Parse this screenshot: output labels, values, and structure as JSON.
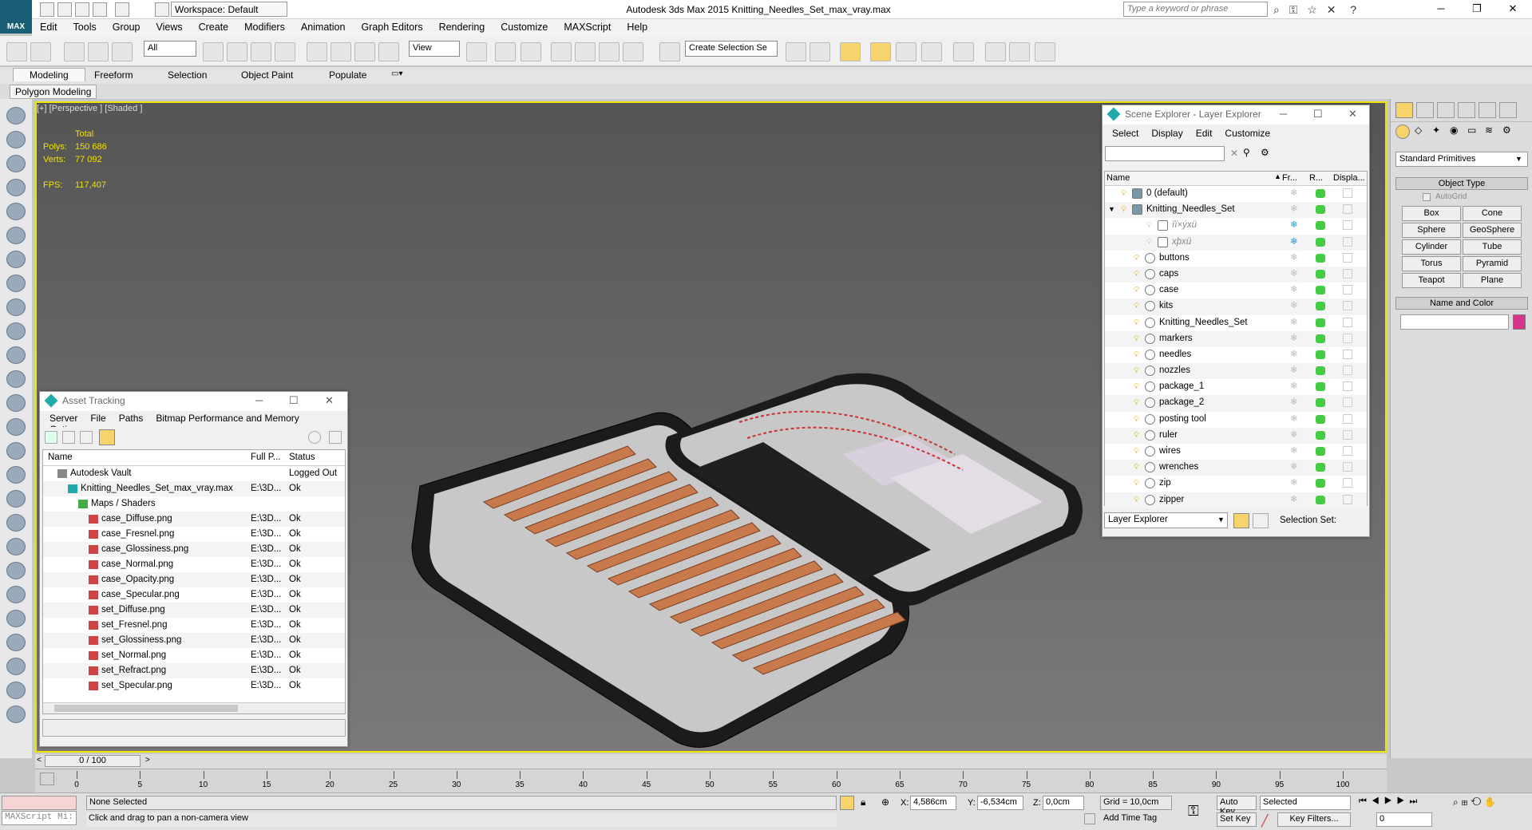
{
  "app": {
    "title": "Autodesk 3ds Max  2015    Knitting_Needles_Set_max_vray.max",
    "logo": "MAX",
    "workspace": "Workspace: Default",
    "search_placeholder": "Type a keyword or phrase"
  },
  "menu": [
    "Edit",
    "Tools",
    "Group",
    "Views",
    "Create",
    "Modifiers",
    "Animation",
    "Graph Editors",
    "Rendering",
    "Customize",
    "MAXScript",
    "Help"
  ],
  "toolbar": {
    "filter": "All",
    "refcoord": "View",
    "selset": "Create Selection Se"
  },
  "ribbon": {
    "tabs": [
      "Modeling",
      "Freeform",
      "Selection",
      "Object Paint",
      "Populate"
    ],
    "sub": "Polygon Modeling"
  },
  "viewport": {
    "label": "[+] [Perspective ] [Shaded ]",
    "stats": {
      "total": "Total",
      "polys_label": "Polys:",
      "polys": "150 686",
      "verts_label": "Verts:",
      "verts": "77 092",
      "fps_label": "FPS:",
      "fps": "117,407"
    }
  },
  "asset": {
    "title": "Asset Tracking",
    "menu": [
      "Server",
      "File",
      "Paths",
      "Bitmap Performance and Memory",
      "Options"
    ],
    "cols": [
      "Name",
      "Full P...",
      "Status"
    ],
    "rows": [
      {
        "name": "Autodesk Vault",
        "path": "",
        "status": "Logged Out",
        "indent": 0
      },
      {
        "name": "Knitting_Needles_Set_max_vray.max",
        "path": "E:\\3D...",
        "status": "Ok",
        "indent": 1
      },
      {
        "name": "Maps / Shaders",
        "path": "",
        "status": "",
        "indent": 2
      },
      {
        "name": "case_Diffuse.png",
        "path": "E:\\3D...",
        "status": "Ok",
        "indent": 3
      },
      {
        "name": "case_Fresnel.png",
        "path": "E:\\3D...",
        "status": "Ok",
        "indent": 3
      },
      {
        "name": "case_Glossiness.png",
        "path": "E:\\3D...",
        "status": "Ok",
        "indent": 3
      },
      {
        "name": "case_Normal.png",
        "path": "E:\\3D...",
        "status": "Ok",
        "indent": 3
      },
      {
        "name": "case_Opacity.png",
        "path": "E:\\3D...",
        "status": "Ok",
        "indent": 3
      },
      {
        "name": "case_Specular.png",
        "path": "E:\\3D...",
        "status": "Ok",
        "indent": 3
      },
      {
        "name": "set_Diffuse.png",
        "path": "E:\\3D...",
        "status": "Ok",
        "indent": 3
      },
      {
        "name": "set_Fresnel.png",
        "path": "E:\\3D...",
        "status": "Ok",
        "indent": 3
      },
      {
        "name": "set_Glossiness.png",
        "path": "E:\\3D...",
        "status": "Ok",
        "indent": 3
      },
      {
        "name": "set_Normal.png",
        "path": "E:\\3D...",
        "status": "Ok",
        "indent": 3
      },
      {
        "name": "set_Refract.png",
        "path": "E:\\3D...",
        "status": "Ok",
        "indent": 3
      },
      {
        "name": "set_Specular.png",
        "path": "E:\\3D...",
        "status": "Ok",
        "indent": 3
      }
    ]
  },
  "scene": {
    "title": "Scene Explorer - Layer Explorer",
    "menu": [
      "Select",
      "Display",
      "Edit",
      "Customize"
    ],
    "cols": [
      "Name",
      "Fr...",
      "R...",
      "Displa..."
    ],
    "rows": [
      {
        "name": "0 (default)",
        "indent": 0
      },
      {
        "name": "Knitting_Needles_Set",
        "indent": 0
      },
      {
        "name": "ïï×ýxü",
        "indent": 2
      },
      {
        "name": "xþxü",
        "indent": 2
      },
      {
        "name": "buttons",
        "indent": 1
      },
      {
        "name": "caps",
        "indent": 1
      },
      {
        "name": "case",
        "indent": 1
      },
      {
        "name": "kits",
        "indent": 1
      },
      {
        "name": "Knitting_Needles_Set",
        "indent": 1
      },
      {
        "name": "markers",
        "indent": 1
      },
      {
        "name": "needles",
        "indent": 1
      },
      {
        "name": "nozzles",
        "indent": 1
      },
      {
        "name": "package_1",
        "indent": 1
      },
      {
        "name": "package_2",
        "indent": 1
      },
      {
        "name": "posting tool",
        "indent": 1
      },
      {
        "name": "ruler",
        "indent": 1
      },
      {
        "name": "wires",
        "indent": 1
      },
      {
        "name": "wrenches",
        "indent": 1
      },
      {
        "name": "zip",
        "indent": 1
      },
      {
        "name": "zipper",
        "indent": 1
      }
    ],
    "footer": "Layer Explorer",
    "selset": "Selection Set:"
  },
  "cmd": {
    "category": "Standard Primitives",
    "object_type": "Object Type",
    "autogrid": "AutoGrid",
    "buttons": [
      "Box",
      "Cone",
      "Sphere",
      "GeoSphere",
      "Cylinder",
      "Tube",
      "Torus",
      "Pyramid",
      "Teapot",
      "Plane"
    ],
    "name_color": "Name and Color",
    "color": "#d6338a"
  },
  "time": {
    "frame": "0 / 100",
    "ticks": [
      "0",
      "5",
      "10",
      "15",
      "20",
      "25",
      "30",
      "35",
      "40",
      "45",
      "50",
      "55",
      "60",
      "65",
      "70",
      "75",
      "80",
      "85",
      "90",
      "95",
      "100"
    ]
  },
  "status": {
    "maxscript": "MAXScript Mi:",
    "selected": "None Selected",
    "prompt": "Click and drag to pan a non-camera view",
    "x": "4,586cm",
    "y": "-6,534cm",
    "z": "0,0cm",
    "x_label": "X:",
    "y_label": "Y:",
    "z_label": "Z:",
    "grid": "Grid = 10,0cm",
    "addtag": "Add Time Tag",
    "autokey": "Auto Key",
    "setkey": "Set Key",
    "keymode": "Selected",
    "keyfilters": "Key Filters...",
    "frame": "0"
  }
}
